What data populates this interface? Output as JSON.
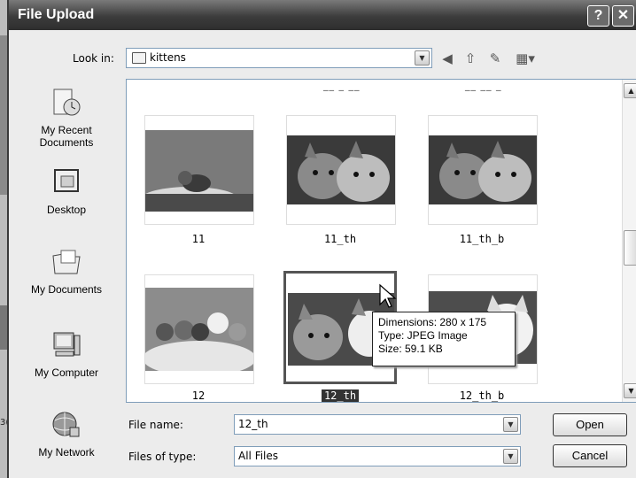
{
  "window": {
    "title": "File Upload",
    "help_glyph": "?",
    "close_glyph": "✕"
  },
  "toolbar": {
    "look_in_label": "Look in:",
    "look_in_value": "kittens",
    "icons": [
      "back-icon",
      "up-folder-icon",
      "new-folder-icon",
      "views-menu-icon"
    ]
  },
  "places": {
    "recent": "My Recent Documents",
    "desktop": "Desktop",
    "documents": "My Documents",
    "computer": "My Computer",
    "network": "My Network"
  },
  "files": {
    "cut_labels": [
      "",
      "__ _ __",
      "__ __ _"
    ],
    "items": [
      {
        "name": "11"
      },
      {
        "name": "11_th"
      },
      {
        "name": "11_th_b"
      },
      {
        "name": "12"
      },
      {
        "name": "12_th",
        "selected": true
      },
      {
        "name": "12_th_b"
      }
    ]
  },
  "tooltip": {
    "dimensions": "Dimensions: 280 x 175",
    "type": "Type: JPEG Image",
    "size": "Size: 59.1 KB"
  },
  "form": {
    "file_name_label": "File name:",
    "file_name_value": "12_th",
    "file_type_label": "Files of type:",
    "file_type_value": "All Files",
    "open_label": "Open",
    "cancel_label": "Cancel"
  },
  "background": {
    "fragment": "3("
  },
  "colors": {
    "titlebar": "#3c3c3c",
    "selection": "#333333",
    "field_border": "#7f9db9"
  }
}
